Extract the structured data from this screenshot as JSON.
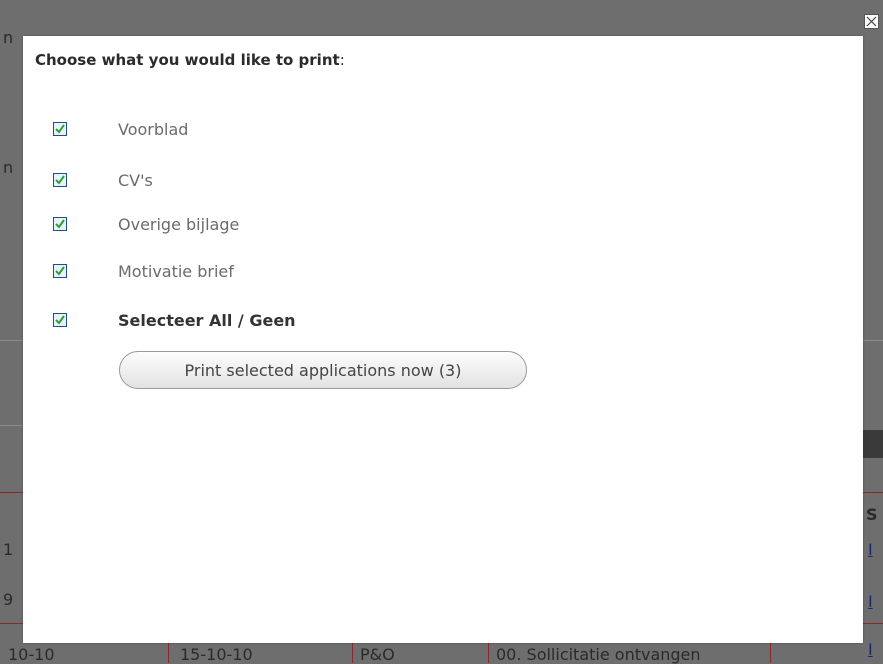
{
  "dialog": {
    "title_main": "Choose what you would like to print",
    "title_colon": ":",
    "options": [
      {
        "label": "Voorblad",
        "checked": true,
        "bold": false
      },
      {
        "label": "CV's",
        "checked": true,
        "bold": false
      },
      {
        "label": "Overige bijlage",
        "checked": true,
        "bold": false
      },
      {
        "label": "Motivatie brief",
        "checked": true,
        "bold": false
      },
      {
        "label": "Selecteer All / Geen",
        "checked": true,
        "bold": true
      }
    ],
    "print_button": "Print selected applications now (3)"
  },
  "background": {
    "row_date_1": "10-10",
    "row_date_2": "15-10-10",
    "row_dept": "P&O",
    "row_status": "00. Sollicitatie ontvangen",
    "frag_n": "n",
    "frag_1": "1",
    "frag_9": "9",
    "frag_s": "S",
    "frag_i": "I"
  },
  "colors": {
    "check_green": "#2ea22e",
    "checkbox_border": "#1e4f86"
  }
}
